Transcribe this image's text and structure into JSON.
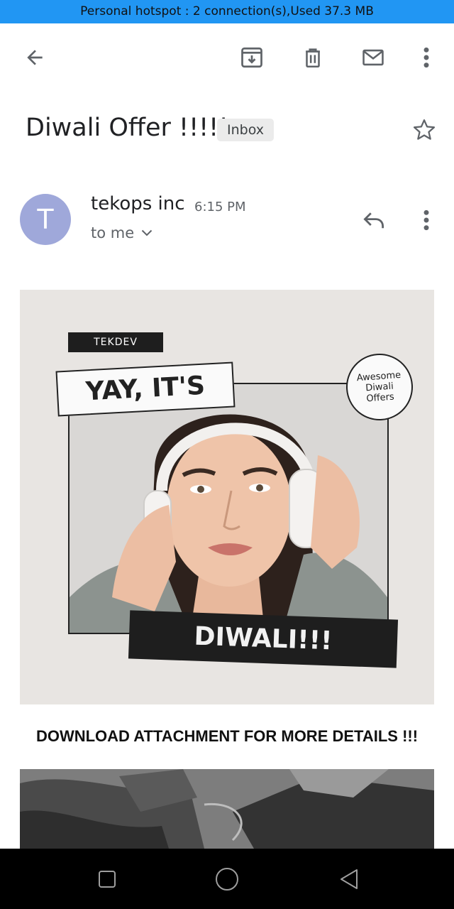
{
  "status_bar": {
    "text": "Personal hotspot : 2 connection(s),Used  37.3 MB",
    "color": "#2196f3"
  },
  "toolbar": {
    "icons": [
      "back-arrow-icon",
      "archive-icon",
      "delete-icon",
      "mark-unread-icon",
      "more-vert-icon"
    ]
  },
  "email": {
    "subject": "Diwali Offer !!!!!",
    "label": "Inbox",
    "sender": {
      "initial": "T",
      "name": "tekops inc",
      "time": "6:15 PM",
      "recipient": "to me",
      "avatar_color": "#9fa8da"
    },
    "banner": {
      "tag": "TEKDEV",
      "headline": "YAY, IT'S",
      "badge_line1": "Awesome",
      "badge_line2": "Diwali",
      "badge_line3": "Offers",
      "footer": "DIWALI!!!"
    },
    "body_text": "DOWNLOAD ATTACHMENT FOR MORE DETAILS !!!"
  },
  "nav_bar": {
    "icons": [
      "recents-square-icon",
      "home-circle-icon",
      "back-triangle-icon"
    ]
  }
}
